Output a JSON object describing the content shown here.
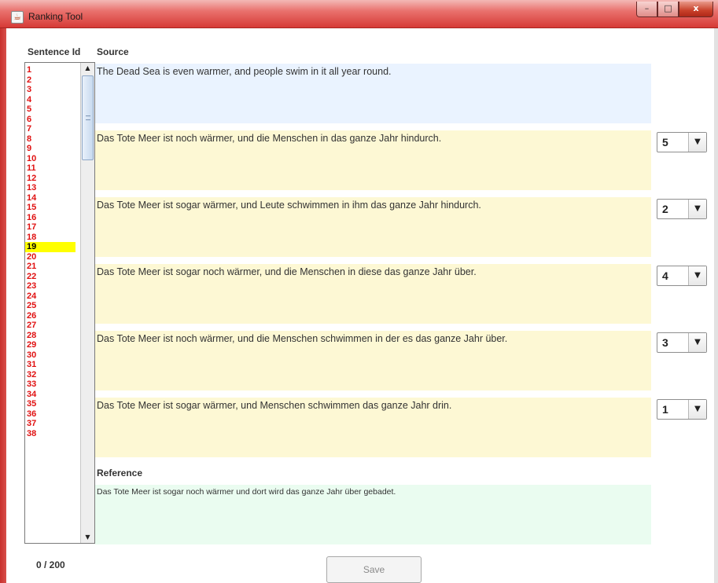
{
  "window": {
    "title": "Ranking Tool",
    "controls": {
      "minimize": "–",
      "maximize": "□",
      "close": "x"
    }
  },
  "labels": {
    "sentence_id": "Sentence Id",
    "source": "Source",
    "reference": "Reference"
  },
  "sentence_ids": [
    "1",
    "2",
    "3",
    "4",
    "5",
    "6",
    "7",
    "8",
    "9",
    "10",
    "11",
    "12",
    "13",
    "14",
    "15",
    "16",
    "17",
    "18",
    "19",
    "20",
    "21",
    "22",
    "23",
    "24",
    "25",
    "26",
    "27",
    "28",
    "29",
    "30",
    "31",
    "32",
    "33",
    "34",
    "35",
    "36",
    "37",
    "38"
  ],
  "selected_id": "19",
  "source_text": "The Dead Sea is even warmer, and people swim in it all year round.",
  "candidates": [
    {
      "text": "Das Tote Meer ist noch wärmer, und die Menschen in das ganze Jahr hindurch.",
      "rank": "5"
    },
    {
      "text": "Das Tote Meer ist sogar wärmer, und Leute schwimmen in ihm das ganze Jahr hindurch.",
      "rank": "2"
    },
    {
      "text": "Das Tote Meer ist sogar noch wärmer, und die Menschen in diese das ganze Jahr über.",
      "rank": "4"
    },
    {
      "text": "Das Tote Meer ist noch wärmer, und die Menschen schwimmen in der es das ganze Jahr über.",
      "rank": "3"
    },
    {
      "text": "Das Tote Meer ist sogar wärmer, und Menschen schwimmen das ganze Jahr drin.",
      "rank": "1"
    }
  ],
  "reference_text": "Das Tote Meer ist sogar noch wärmer und dort wird das ganze Jahr über gebadet.",
  "progress": "0 / 200",
  "save_label": "Save",
  "colors": {
    "id_text": "#e01010",
    "selected_bg": "#ffff00",
    "source_bg": "#eaf3ff",
    "candidate_bg": "#fdf8d4",
    "reference_bg": "#eafcf0"
  }
}
